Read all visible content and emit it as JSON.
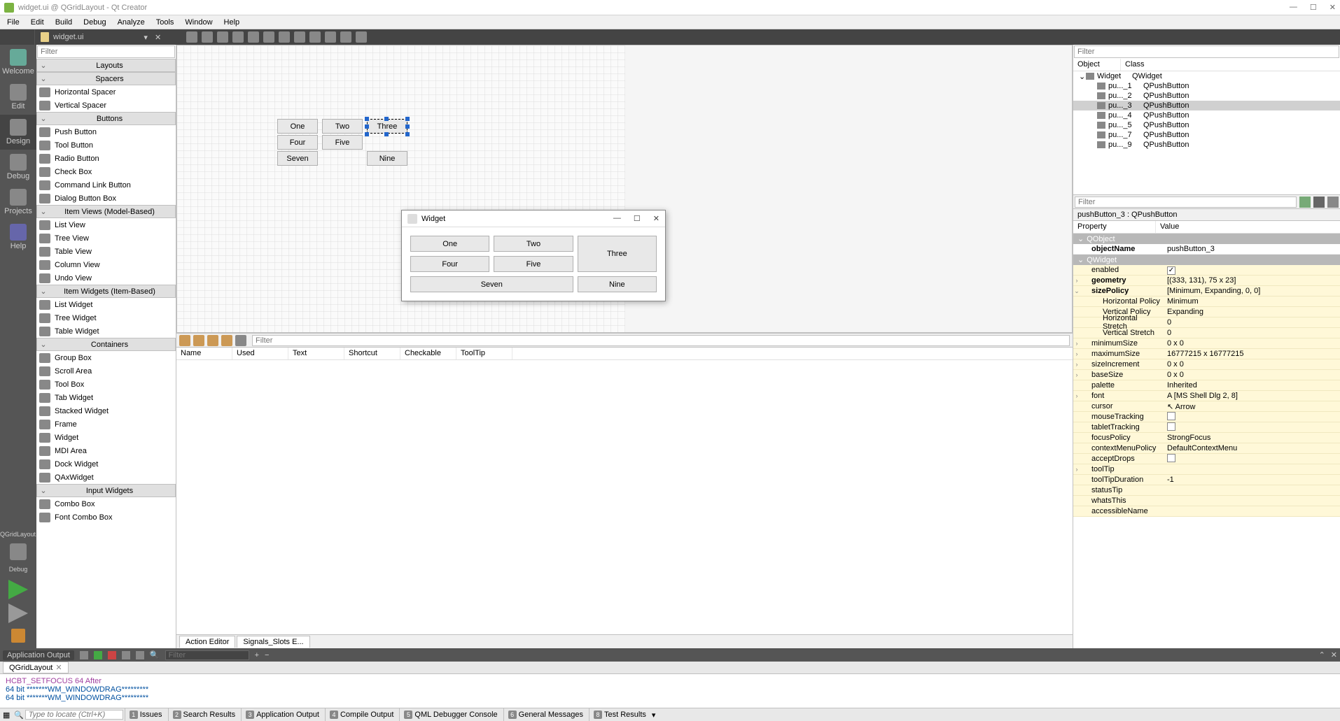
{
  "title": "widget.ui @ QGridLayout - Qt Creator",
  "menubar": [
    "File",
    "Edit",
    "Build",
    "Debug",
    "Analyze",
    "Tools",
    "Window",
    "Help"
  ],
  "open_file": "widget.ui",
  "left_rail": {
    "items": [
      "Welcome",
      "Edit",
      "Design",
      "Debug",
      "Projects",
      "Help"
    ],
    "config": "QGridLayout...",
    "config2": "Debug"
  },
  "widget_box": {
    "filter_placeholder": "Filter",
    "groups": [
      {
        "name": "Layouts",
        "items": []
      },
      {
        "name": "Spacers",
        "items": [
          "Horizontal Spacer",
          "Vertical Spacer"
        ]
      },
      {
        "name": "Buttons",
        "items": [
          "Push Button",
          "Tool Button",
          "Radio Button",
          "Check Box",
          "Command Link Button",
          "Dialog Button Box"
        ]
      },
      {
        "name": "Item Views (Model-Based)",
        "items": [
          "List View",
          "Tree View",
          "Table View",
          "Column View",
          "Undo View"
        ]
      },
      {
        "name": "Item Widgets (Item-Based)",
        "items": [
          "List Widget",
          "Tree Widget",
          "Table Widget"
        ]
      },
      {
        "name": "Containers",
        "items": [
          "Group Box",
          "Scroll Area",
          "Tool Box",
          "Tab Widget",
          "Stacked Widget",
          "Frame",
          "Widget",
          "MDI Area",
          "Dock Widget",
          "QAxWidget"
        ]
      },
      {
        "name": "Input Widgets",
        "items": [
          "Combo Box",
          "Font Combo Box"
        ]
      }
    ]
  },
  "design_buttons": {
    "one": "One",
    "two": "Two",
    "three": "Three",
    "four": "Four",
    "five": "Five",
    "seven": "Seven",
    "nine": "Nine"
  },
  "preview": {
    "title": "Widget",
    "buttons": {
      "one": "One",
      "two": "Two",
      "three": "Three",
      "four": "Four",
      "five": "Five",
      "seven": "Seven",
      "nine": "Nine"
    }
  },
  "action_editor": {
    "filter_placeholder": "Filter",
    "columns": [
      "Name",
      "Used",
      "Text",
      "Shortcut",
      "Checkable",
      "ToolTip"
    ],
    "tabs": [
      "Action Editor",
      "Signals_Slots E..."
    ]
  },
  "object_inspector": {
    "filter_placeholder": "Filter",
    "columns": [
      "Object",
      "Class"
    ],
    "rows": [
      {
        "name": "Widget",
        "class": "QWidget",
        "indent": 0,
        "selected": false,
        "expander": true
      },
      {
        "name": "pu..._1",
        "class": "QPushButton",
        "indent": 1
      },
      {
        "name": "pu..._2",
        "class": "QPushButton",
        "indent": 1
      },
      {
        "name": "pu..._3",
        "class": "QPushButton",
        "indent": 1,
        "selected": true
      },
      {
        "name": "pu..._4",
        "class": "QPushButton",
        "indent": 1
      },
      {
        "name": "pu..._5",
        "class": "QPushButton",
        "indent": 1
      },
      {
        "name": "pu..._7",
        "class": "QPushButton",
        "indent": 1
      },
      {
        "name": "pu..._9",
        "class": "QPushButton",
        "indent": 1
      }
    ]
  },
  "property_editor": {
    "filter_placeholder": "Filter",
    "label": "pushButton_3 : QPushButton",
    "columns": [
      "Property",
      "Value"
    ],
    "sections": [
      {
        "name": "QObject",
        "rows": [
          {
            "name": "objectName",
            "value": "pushButton_3",
            "bold": true
          }
        ],
        "yellow": false
      },
      {
        "name": "QWidget",
        "rows": [
          {
            "name": "enabled",
            "value": "__check_on__"
          },
          {
            "name": "geometry",
            "value": "[(333, 131), 75 x 23]",
            "bold": true,
            "exp": true
          },
          {
            "name": "sizePolicy",
            "value": "[Minimum, Expanding, 0, 0]",
            "bold": true,
            "exp": true,
            "expanded": true
          },
          {
            "name": "Horizontal Policy",
            "value": "Minimum",
            "sub": true
          },
          {
            "name": "Vertical Policy",
            "value": "Expanding",
            "sub": true
          },
          {
            "name": "Horizontal Stretch",
            "value": "0",
            "sub": true
          },
          {
            "name": "Vertical Stretch",
            "value": "0",
            "sub": true
          },
          {
            "name": "minimumSize",
            "value": "0 x 0",
            "exp": true
          },
          {
            "name": "maximumSize",
            "value": "16777215 x 16777215",
            "exp": true
          },
          {
            "name": "sizeIncrement",
            "value": "0 x 0",
            "exp": true
          },
          {
            "name": "baseSize",
            "value": "0 x 0",
            "exp": true
          },
          {
            "name": "palette",
            "value": "Inherited"
          },
          {
            "name": "font",
            "value": "A   [MS Shell Dlg 2, 8]",
            "exp": true
          },
          {
            "name": "cursor",
            "value": "↖   Arrow"
          },
          {
            "name": "mouseTracking",
            "value": "__check_off__"
          },
          {
            "name": "tabletTracking",
            "value": "__check_off__"
          },
          {
            "name": "focusPolicy",
            "value": "StrongFocus"
          },
          {
            "name": "contextMenuPolicy",
            "value": "DefaultContextMenu"
          },
          {
            "name": "acceptDrops",
            "value": "__check_off__"
          },
          {
            "name": "toolTip",
            "value": "",
            "exp": true
          },
          {
            "name": "toolTipDuration",
            "value": "-1"
          },
          {
            "name": "statusTip",
            "value": ""
          },
          {
            "name": "whatsThis",
            "value": ""
          },
          {
            "name": "accessibleName",
            "value": ""
          }
        ],
        "yellow": true
      }
    ]
  },
  "output": {
    "tab": "Application Output",
    "run_label": "QGridLayout",
    "filter_placeholder": "Filter",
    "lines": [
      {
        "text": "HCBT_SETFOCUS 64 After",
        "cls": "l1"
      },
      {
        "text": "64 bit *******WM_WINDOWDRAG*********",
        "cls": "l2"
      },
      {
        "text": "64 bit *******WM_WINDOWDRAG*********",
        "cls": "l2"
      }
    ]
  },
  "statusbar": {
    "search_placeholder": "Type to locate (Ctrl+K)",
    "panes": [
      "Issues",
      "Search Results",
      "Application Output",
      "Compile Output",
      "QML Debugger Console",
      "General Messages",
      "Test Results"
    ]
  }
}
